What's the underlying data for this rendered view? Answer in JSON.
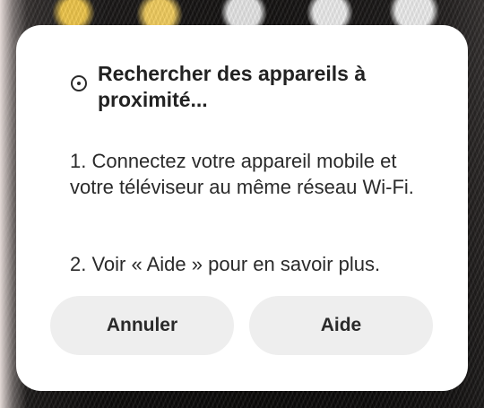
{
  "dialog": {
    "title": "Rechercher des appareils à proximité...",
    "step1": "1. Connectez votre appareil mobile et votre téléviseur au même réseau Wi-Fi.",
    "step2": "2. Voir « Aide » pour en savoir plus.",
    "buttons": {
      "cancel": "Annuler",
      "help": "Aide"
    },
    "icon": "spinner-icon"
  }
}
